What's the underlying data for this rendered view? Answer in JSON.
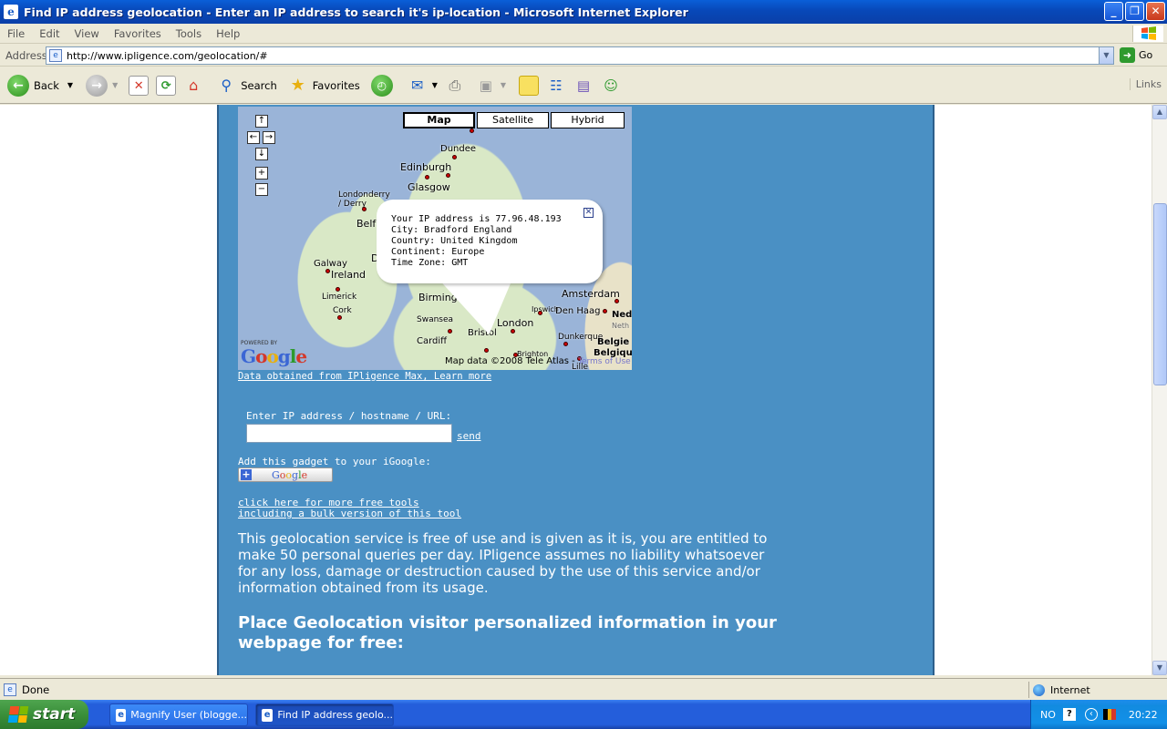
{
  "window": {
    "title": "Find IP address geolocation - Enter an IP address to search it's ip-location - Microsoft Internet Explorer",
    "minimize": "_",
    "maximize": "❐",
    "close": "✕"
  },
  "menu": [
    "File",
    "Edit",
    "View",
    "Favorites",
    "Tools",
    "Help"
  ],
  "address": {
    "label": "Address",
    "url": "http://www.ipligence.com/geolocation/#",
    "go_label": "Go"
  },
  "toolbar": {
    "back_label": "Back",
    "search_label": "Search",
    "favorites_label": "Favorites",
    "links_label": "Links"
  },
  "map": {
    "types": [
      "Map",
      "Satellite",
      "Hybrid"
    ],
    "active_type": "Map",
    "cities": [
      "Dundee",
      "Edinburgh",
      "Glasgow",
      "Londonderry / Derry",
      "Belfa",
      "Galway",
      "Ireland",
      "Limerick",
      "Cork",
      "Birmingham",
      "Swansea",
      "Cardiff",
      "Bristol",
      "London",
      "Ipswich",
      "Brighton",
      "Amsterdam",
      "Den Haag",
      "Nede",
      "Neth",
      "Dunkerque",
      "Belgie",
      "Belgique",
      "Lille",
      "D"
    ],
    "powered_by": "POWERED BY",
    "logo_letters": [
      "G",
      "o",
      "o",
      "g",
      "l",
      "e"
    ],
    "copyright": "Map data ©2008 Tele Atlas -",
    "terms": "Terms of Use"
  },
  "info_window": {
    "lines": [
      "Your IP address is 77.96.48.193",
      "City: Bradford England",
      "Country: United Kingdom",
      "Continent: Europe",
      "Time Zone: GMT"
    ]
  },
  "page": {
    "map_source_link": "Data obtained from IPligence Max, Learn more",
    "ip_label": "Enter IP address / hostname / URL:",
    "ip_value": "",
    "send_link": "send",
    "gadget_label": "Add this gadget to your iGoogle:",
    "gadget_plus": "+",
    "gadget_letters": [
      "G",
      "o",
      "o",
      "g",
      "l",
      "e"
    ],
    "tools_link_1": "click here for more free tools",
    "tools_link_2": "including a bulk version of this tool",
    "disclaimer": "This geolocation service is free of use and is given as it is, you are entitled to make 50 personal queries per day. IPligence assumes no liability whatsoever for any loss, damage or destruction caused by the use of this service and/or information obtained from its usage.",
    "place_heading": "Place Geolocation visitor personalized information in your webpage for free:"
  },
  "status": {
    "text": "Done",
    "zone": "Internet"
  },
  "taskbar": {
    "start_label": "start",
    "tasks": [
      "Magnify User (blogge...",
      "Find IP address geolo..."
    ],
    "active_task": 1,
    "lang": "NO",
    "clock": "20:22"
  }
}
